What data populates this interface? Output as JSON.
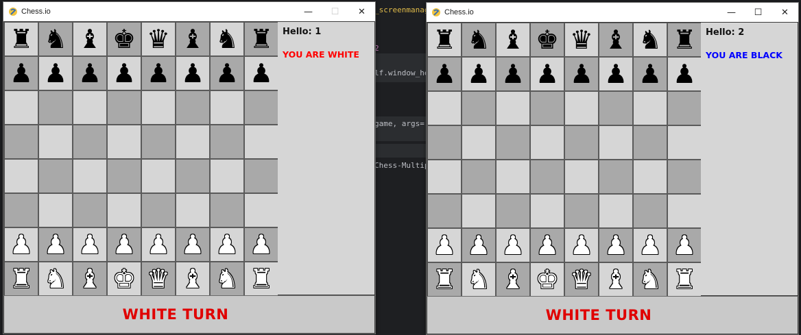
{
  "colors": {
    "light_square": "#d6d6d6",
    "dark_square": "#a9a9a9",
    "white_msg": "#ff0000",
    "black_msg": "#0000ff",
    "turn_text": "#e00000"
  },
  "background_editor": {
    "lines": [
      "_screenmanager.set_screen(self.menu_screen)",
      "2",
      "lf.window_he",
      "game, args=(",
      "Chess-Multip"
    ]
  },
  "windows": [
    {
      "title": "Chess.io",
      "icon": "pygame-snake-icon",
      "controls": {
        "minimize": "—",
        "maximize": "☐",
        "close": "✕"
      },
      "hello": "Hello: 1",
      "color_message": "YOU ARE WHITE",
      "turn": "WHITE TURN"
    },
    {
      "title": "Chess.io",
      "icon": "pygame-snake-icon",
      "controls": {
        "minimize": "—",
        "maximize": "☐",
        "close": "✕"
      },
      "hello": "Hello: 2",
      "color_message": "YOU ARE BLACK",
      "turn": "WHITE TURN"
    }
  ],
  "board": {
    "rows": [
      [
        "bR",
        "bN",
        "bB",
        "bK",
        "bQ",
        "bB",
        "bN",
        "bR"
      ],
      [
        "bP",
        "bP",
        "bP",
        "bP",
        "bP",
        "bP",
        "bP",
        "bP"
      ],
      [
        "",
        "",
        "",
        "",
        "",
        "",
        "",
        ""
      ],
      [
        "",
        "",
        "",
        "",
        "",
        "",
        "",
        ""
      ],
      [
        "",
        "",
        "",
        "",
        "",
        "",
        "",
        ""
      ],
      [
        "",
        "",
        "",
        "",
        "",
        "",
        "",
        ""
      ],
      [
        "wP",
        "wP",
        "wP",
        "wP",
        "wP",
        "wP",
        "wP",
        "wP"
      ],
      [
        "wR",
        "wN",
        "wB",
        "wK",
        "wQ",
        "wB",
        "wN",
        "wR"
      ]
    ],
    "glyphs": {
      "K": "♚",
      "Q": "♛",
      "R": "♜",
      "B": "♝",
      "N": "♞",
      "P": "♟"
    }
  }
}
